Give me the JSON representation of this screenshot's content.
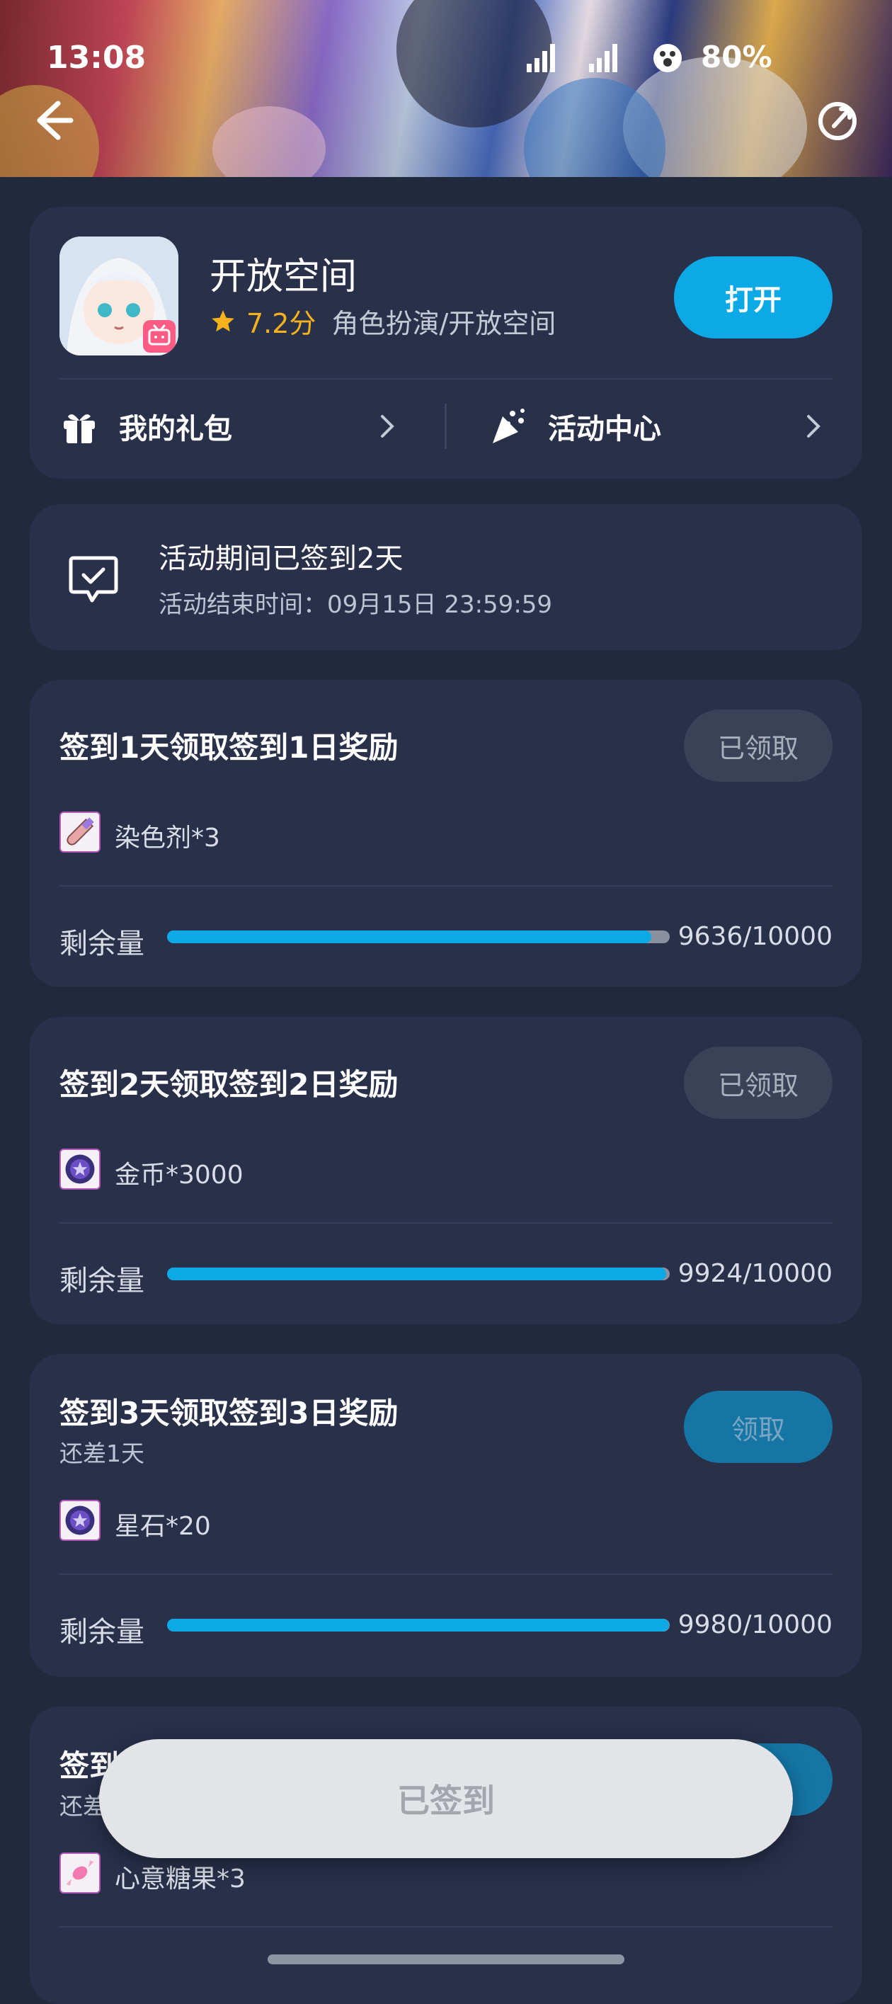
{
  "status_bar": {
    "time": "13:08",
    "battery": "80%"
  },
  "app": {
    "name": "开放空间",
    "rating": "7.2分",
    "category": "角色扮演/开放空间",
    "open_label": "打开"
  },
  "links": {
    "gifts_label": "我的礼包",
    "events_label": "活动中心"
  },
  "checkin": {
    "title": "活动期间已签到2天",
    "end_time": "活动结束时间：09月15日 23:59:59"
  },
  "stock_label": "剩余量",
  "tasks": [
    {
      "title": "签到1天领取签到1日奖励",
      "remaining": "",
      "button": "已领取",
      "reward": "染色剂*3",
      "stock": "9636/10000",
      "stock_fraction": 0.9636
    },
    {
      "title": "签到2天领取签到2日奖励",
      "remaining": "",
      "button": "已领取",
      "reward": "金币*3000",
      "stock": "9924/10000",
      "stock_fraction": 0.9924
    },
    {
      "title": "签到3天领取签到3日奖励",
      "remaining": "还差1天",
      "button": "领取",
      "reward": "星石*20",
      "stock": "9980/10000",
      "stock_fraction": 0.998
    },
    {
      "title_visible": "签到",
      "remaining_visible": "还差",
      "reward": "心意糖果*3"
    }
  ],
  "toast": {
    "label": "已签到"
  },
  "colors": {
    "background": "#21293d",
    "card": "#28304a",
    "accent": "#0ba9e6",
    "rating": "#f5b21b"
  },
  "icons": [
    "back-arrow-icon",
    "share-icon",
    "gift-icon",
    "party-popper-icon",
    "chevron-right-icon",
    "chat-check-icon",
    "dye-icon",
    "coin-icon",
    "star-stone-icon",
    "candy-icon",
    "star-icon",
    "tv-badge-icon"
  ]
}
